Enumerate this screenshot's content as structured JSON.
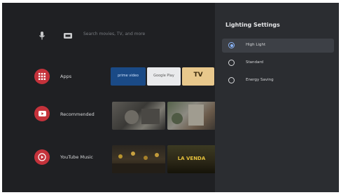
{
  "search": {
    "placeholder": "Search movies, TV, and more"
  },
  "rows": [
    {
      "label": "Apps",
      "icon": "apps-grid-icon",
      "tiles": [
        "prime video",
        "Google Play",
        "TV"
      ]
    },
    {
      "label": "Recommended",
      "icon": "youtube-icon"
    },
    {
      "label": "YouTube Music",
      "icon": "youtube-music-icon",
      "tile_caption": "LA VENDA"
    }
  ],
  "panel": {
    "title": "Lighting Settings",
    "options": [
      {
        "label": "High Light",
        "selected": true
      },
      {
        "label": "Standard",
        "selected": false
      },
      {
        "label": "Energy Saving",
        "selected": false
      }
    ]
  },
  "colors": {
    "background": "#1f2023",
    "panel": "#2b2d31",
    "accent_red": "#c4323b",
    "radio_selected": "#8ab4f8"
  }
}
